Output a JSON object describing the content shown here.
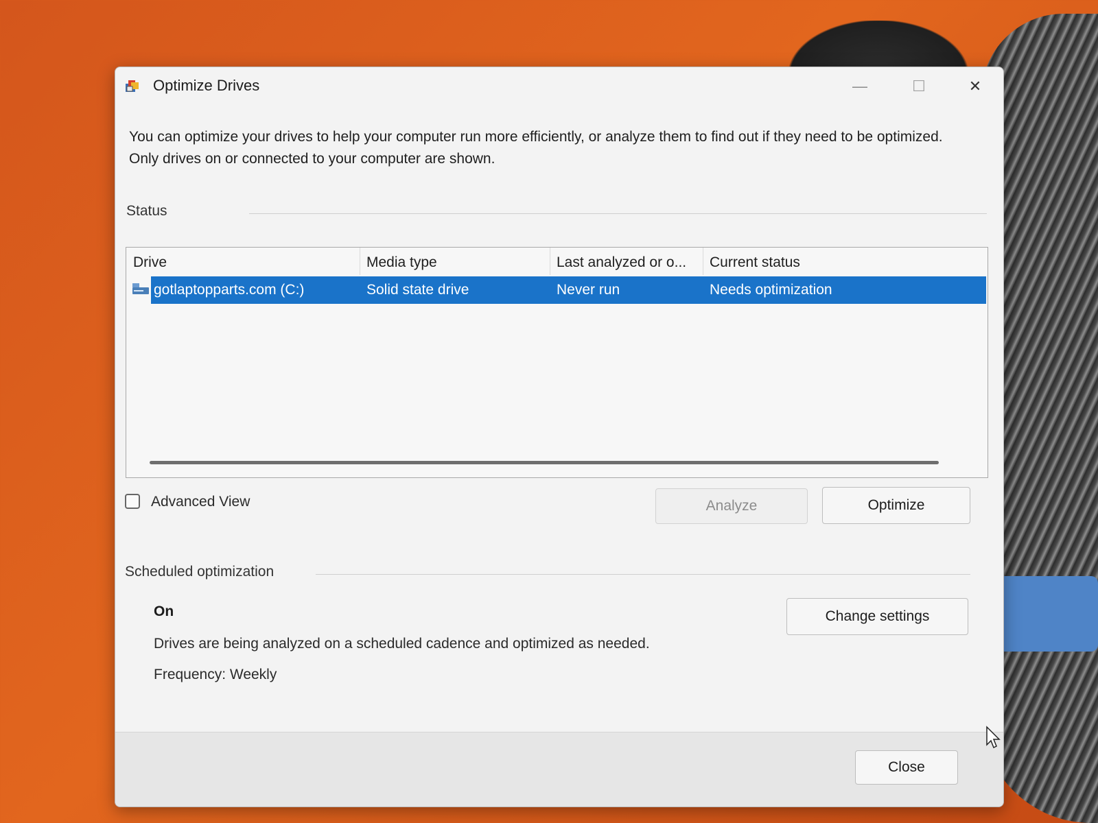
{
  "window": {
    "title": "Optimize Drives",
    "minimize_glyph": "—",
    "maximize_glyph": "☐",
    "close_glyph": "✕"
  },
  "intro_text": "You can optimize your drives to help your computer run more efficiently, or analyze them to find out if they need to be optimized. Only drives on or connected to your computer are shown.",
  "status": {
    "label": "Status",
    "columns": [
      "Drive",
      "Media type",
      "Last analyzed or o...",
      "Current status"
    ],
    "rows": [
      {
        "drive": "gotlaptopparts.com (C:)",
        "media_type": "Solid state drive",
        "last_analyzed": "Never run",
        "current_status": "Needs optimization",
        "selected": true
      }
    ]
  },
  "advanced_view": {
    "label": "Advanced View",
    "checked": false
  },
  "buttons": {
    "analyze": "Analyze",
    "optimize": "Optimize",
    "change_settings": "Change settings",
    "close": "Close"
  },
  "scheduled": {
    "label": "Scheduled optimization",
    "state": "On",
    "description": "Drives are being analyzed on a scheduled cadence and optimized as needed.",
    "frequency": "Frequency: Weekly"
  },
  "colors": {
    "selection": "#1a73c9",
    "background": "#e2661e"
  },
  "icons": {
    "app": "optimize-drives-icon",
    "drive": "drive-icon",
    "cursor": "mouse-pointer-icon"
  }
}
